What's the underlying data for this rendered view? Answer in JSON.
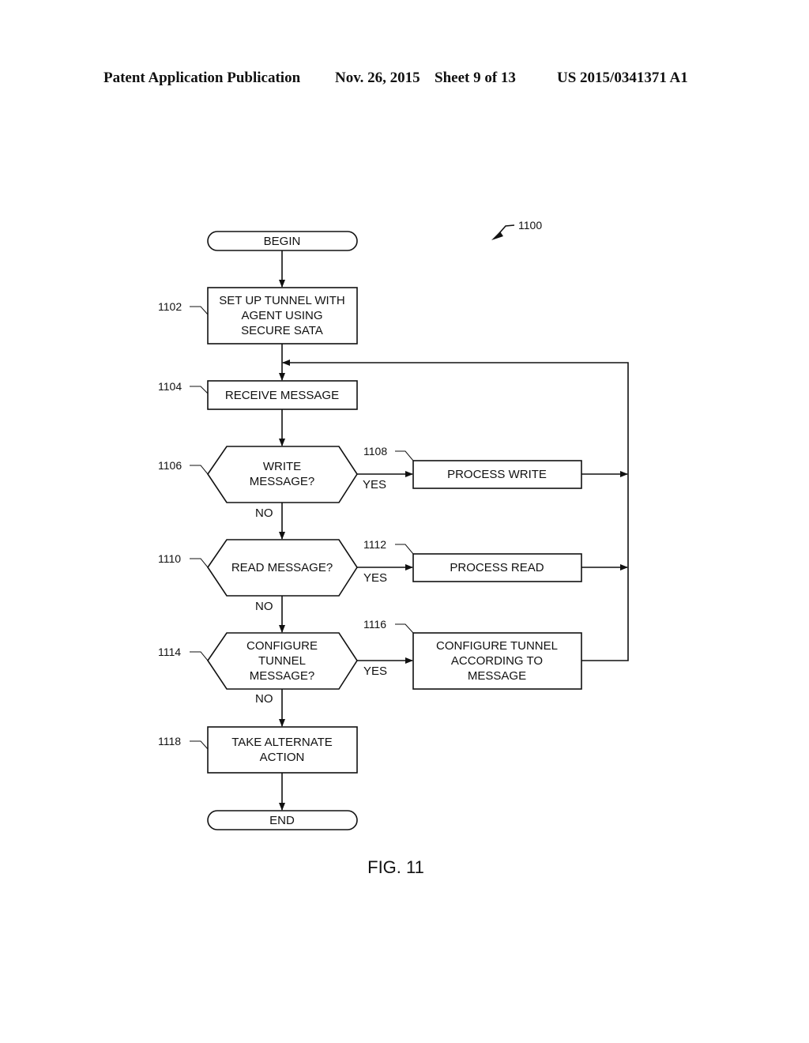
{
  "header": {
    "publication": "Patent Application Publication",
    "date": "Nov. 26, 2015",
    "sheet": "Sheet 9 of 13",
    "patent_number": "US 2015/0341371 A1"
  },
  "diagram": {
    "ref": "1100",
    "figure_label": "FIG. 11",
    "nodes": {
      "begin": {
        "lines": [
          "BEGIN"
        ]
      },
      "n1102": {
        "ref": "1102",
        "lines": [
          "SET UP TUNNEL WITH",
          "AGENT USING",
          "SECURE SATA"
        ]
      },
      "n1104": {
        "ref": "1104",
        "lines": [
          "RECEIVE MESSAGE"
        ]
      },
      "n1106": {
        "ref": "1106",
        "lines": [
          "WRITE",
          "MESSAGE?"
        ]
      },
      "n1108": {
        "ref": "1108",
        "lines": [
          "PROCESS WRITE"
        ]
      },
      "n1110": {
        "ref": "1110",
        "lines": [
          "READ MESSAGE?"
        ]
      },
      "n1112": {
        "ref": "1112",
        "lines": [
          "PROCESS READ"
        ]
      },
      "n1114": {
        "ref": "1114",
        "lines": [
          "CONFIGURE",
          "TUNNEL",
          "MESSAGE?"
        ]
      },
      "n1116": {
        "ref": "1116",
        "lines": [
          "CONFIGURE TUNNEL",
          "ACCORDING TO",
          "MESSAGE"
        ]
      },
      "n1118": {
        "ref": "1118",
        "lines": [
          "TAKE ALTERNATE",
          "ACTION"
        ]
      },
      "end": {
        "lines": [
          "END"
        ]
      }
    },
    "edge_labels": {
      "yes": "YES",
      "no": "NO"
    }
  }
}
